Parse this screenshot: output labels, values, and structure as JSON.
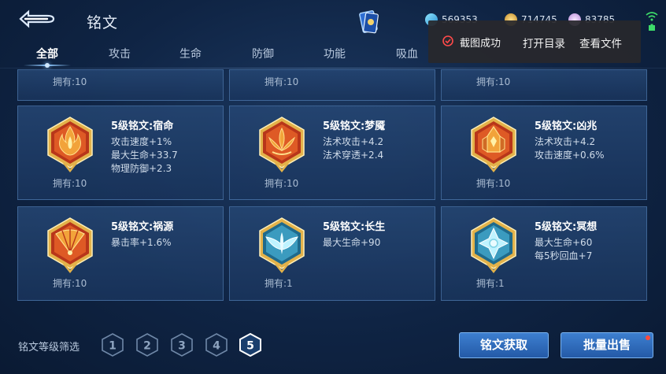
{
  "header": {
    "title": "铭文",
    "currencies": [
      {
        "name": "diamond",
        "value": "569353"
      },
      {
        "name": "gold",
        "value": "714745"
      },
      {
        "name": "crystal",
        "value": "83785"
      }
    ]
  },
  "tabs": [
    {
      "label": "全部",
      "active": true
    },
    {
      "label": "攻击"
    },
    {
      "label": "生命"
    },
    {
      "label": "防御"
    },
    {
      "label": "功能"
    },
    {
      "label": "吸血"
    }
  ],
  "toast": {
    "message": "截图成功",
    "open_dir": "打开目录",
    "view_file": "查看文件"
  },
  "top_row_owned": [
    "拥有:10",
    "拥有:10",
    "拥有:10"
  ],
  "cards": [
    {
      "title": "5级铭文:宿命",
      "stats": [
        "攻击速度+1%",
        "最大生命+33.7",
        "物理防御+2.3"
      ],
      "owned": "拥有:10",
      "color": "red",
      "icon": "flame-rune-icon"
    },
    {
      "title": "5级铭文:梦魇",
      "stats": [
        "法术攻击+4.2",
        "法术穿透+2.4"
      ],
      "owned": "拥有:10",
      "color": "red",
      "icon": "lotus-rune-icon"
    },
    {
      "title": "5级铭文:凶兆",
      "stats": [
        "法术攻击+4.2",
        "攻击速度+0.6%"
      ],
      "owned": "拥有:10",
      "color": "red",
      "icon": "throne-rune-icon"
    },
    {
      "title": "5级铭文:祸源",
      "stats": [
        "暴击率+1.6%"
      ],
      "owned": "拥有:10",
      "color": "red",
      "icon": "fan-rune-icon"
    },
    {
      "title": "5级铭文:长生",
      "stats": [
        "最大生命+90"
      ],
      "owned": "拥有:1",
      "color": "blue",
      "icon": "wings-rune-icon"
    },
    {
      "title": "5级铭文:冥想",
      "stats": [
        "最大生命+60",
        "每5秒回血+7"
      ],
      "owned": "拥有:1",
      "color": "blue",
      "icon": "crystal-rune-icon"
    }
  ],
  "filter": {
    "label": "铭文等级筛选",
    "levels": [
      "1",
      "2",
      "3",
      "4",
      "5"
    ],
    "selected": "5"
  },
  "buttons": {
    "acquire": "铭文获取",
    "bulk_sell": "批量出售"
  },
  "colors": {
    "accent": "#2f6fc2",
    "red_rune": "#c8431e",
    "blue_rune": "#7fd3e6",
    "gold_frame": "#e3b24a"
  }
}
